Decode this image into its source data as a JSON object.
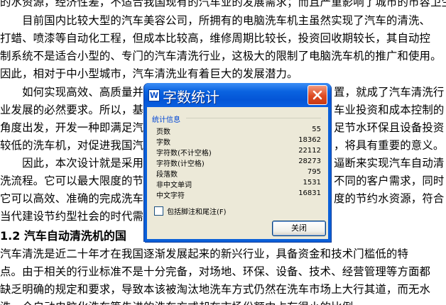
{
  "document": {
    "lines": [
      "的水资源，经济性差，不适合我国现有的汽车业的发展需求；而且严重影响了城市的市容卫生。",
      "　　目前国内比较大型的汽车美容公司，所拥有的电脑洗车机主虽然实现了汽车的清洗、",
      "打蜡、喷漆等自动化工程，但成本比较高，维修周期比较长，投资回收期较长，其自动控",
      "制系统不是适合小型的、专门的汽车清洗行业，这极大的限制了电脑洗车机的推广和使用。",
      "因此，相对于中小型城市，汽车清洗业有着巨大的发展潜力。",
      "　　如何实现高效、高质量并",
      "业发展的必然要求。所以，基",
      "角度出发，开发一种即满足汽",
      "较低的洗车机，对促进我国汽",
      "　　因此，本次设计就是采用",
      "洗流程。它可以最大限度的节",
      "它可以高效、准确的完成洗车",
      "当代建设节约型社会的时代需",
      "汽车清洗是近二十年才在我国逐渐发展起来的新兴行业，具备资金和技术门槛低的特",
      "点。由于相关的行业标准不是十分完备，对场地、环保、设备、技术、经营管理等方面都",
      "缺乏明确的规定和要求，导致本该被淘汰地洗车方式仍然在洗车市场上大行其道，而无水",
      "洗、全自动电脑化洗车等先进的洗车方式却在市场份额中占有很小的比例。"
    ],
    "right_fragments": [
      "置，就成了汽车清洗行",
      "车业投资和成本控制的",
      "足节水环保且设备投资",
      "，将具有重要的意义。",
      "逼断来实现汽车自动清",
      "不同的客户需求，同时",
      "度的节约水资源，符合"
    ],
    "heading": "1.2  汽车自动清洗机的国"
  },
  "dialog": {
    "title": "字数统计",
    "app_icon_letter": "W",
    "group_label": "统计信息",
    "stats": [
      {
        "label": "页数",
        "value": "55"
      },
      {
        "label": "字数",
        "value": "18362"
      },
      {
        "label": "字符数(不计空格)",
        "value": "22112"
      },
      {
        "label": "字符数(计空格)",
        "value": "28273"
      },
      {
        "label": "段落数",
        "value": "795"
      },
      {
        "label": "非中文单词",
        "value": "1531"
      },
      {
        "label": "中文字符",
        "value": "16831"
      }
    ],
    "checkbox_label": "包括脚注和尾注(F)",
    "checkbox_checked": false,
    "close_button_label": "关闭",
    "colors": {
      "titlebar": "#0a5fd8",
      "close_x": "#dd4a22",
      "body": "#ece9d8",
      "group_label": "#0046d5"
    }
  }
}
